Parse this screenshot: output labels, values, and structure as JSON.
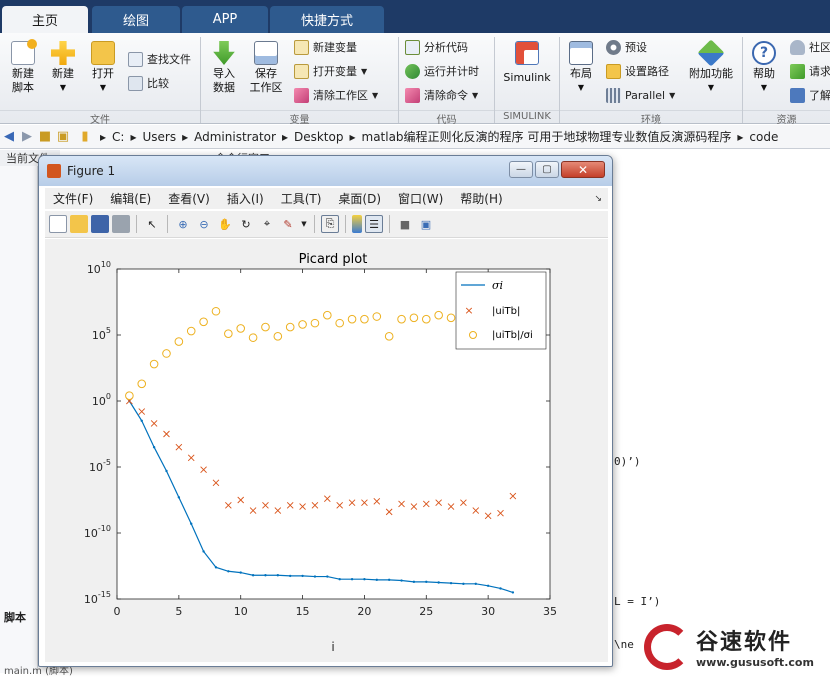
{
  "tabs": [
    {
      "label": "主页",
      "active": true
    },
    {
      "label": "绘图",
      "active": false
    },
    {
      "label": "APP",
      "active": false
    },
    {
      "label": "快捷方式",
      "active": false
    }
  ],
  "ribbon": {
    "file": {
      "new_script": "新建\n脚本",
      "new": "新建",
      "open": "打开",
      "find_files": "查找文件",
      "compare": "比较",
      "section": "文件"
    },
    "variable": {
      "import_data": "导入\n数据",
      "save_workspace": "保存\n工作区",
      "new_variable": "新建变量",
      "open_variable": "打开变量",
      "clear_workspace": "清除工作区",
      "section": "变量"
    },
    "code": {
      "analyze_code": "分析代码",
      "run_and_time": "运行并计时",
      "clear_commands": "清除命令",
      "section": "代码"
    },
    "simulink": {
      "simulink": "Simulink",
      "section": "SIMULINK"
    },
    "environment": {
      "layout": "布局",
      "preferences": "预设",
      "set_path": "设置路径",
      "parallel": "Parallel",
      "addons": "附加功能",
      "section": "环境"
    },
    "resources": {
      "help": "帮助",
      "community": "社区",
      "request": "请求",
      "learn": "了解",
      "section": "资源"
    }
  },
  "address": {
    "parts": [
      "C:",
      "Users",
      "Administrator",
      "Desktop",
      "matlab编程正则化反演的程序 可用于地球物理专业数值反演源码程序",
      "code"
    ]
  },
  "background": {
    "current_folder": "当前文件夹",
    "command_window": "命令行窗口",
    "snip1": "0)’)",
    "snip2": "L = I’)",
    "snip3": "\\ne",
    "script_label": "脚本",
    "main_file": "main.m (脚本)"
  },
  "figure": {
    "title": "Figure 1",
    "menu": [
      "文件(F)",
      "编辑(E)",
      "查看(V)",
      "插入(I)",
      "工具(T)",
      "桌面(D)",
      "窗口(W)",
      "帮助(H)"
    ]
  },
  "chart_data": {
    "type": "scatter",
    "title": "Picard plot",
    "xlabel": "i",
    "ylabel": "",
    "xlim": [
      0,
      35
    ],
    "ylim_exponent": [
      -15,
      10
    ],
    "yscale": "log",
    "xticks": [
      0,
      5,
      10,
      15,
      20,
      25,
      30,
      35
    ],
    "yticks_exp": [
      -15,
      -10,
      -5,
      0,
      5,
      10
    ],
    "grid": false,
    "legend": {
      "position": "top-right"
    },
    "series": [
      {
        "name": "σi",
        "style": "line",
        "color": "#0072bd",
        "x": [
          1,
          2,
          3,
          4,
          5,
          6,
          7,
          8,
          9,
          10,
          11,
          12,
          13,
          14,
          15,
          16,
          17,
          18,
          19,
          20,
          21,
          22,
          23,
          24,
          25,
          26,
          27,
          28,
          29,
          30,
          31,
          32
        ],
        "log10_y": [
          0,
          -1.5,
          -3.5,
          -5.3,
          -7.3,
          -9.3,
          -11.4,
          -12.6,
          -12.9,
          -13.0,
          -13.2,
          -13.2,
          -13.2,
          -13.25,
          -13.25,
          -13.3,
          -13.3,
          -13.5,
          -13.5,
          -13.5,
          -13.55,
          -13.55,
          -13.6,
          -13.7,
          -13.7,
          -13.75,
          -13.8,
          -13.85,
          -13.85,
          -14.0,
          -14.2,
          -14.5
        ]
      },
      {
        "name": "|uiTb|",
        "style": "x",
        "color": "#d95319",
        "x": [
          1,
          2,
          3,
          4,
          5,
          6,
          7,
          8,
          9,
          10,
          11,
          12,
          13,
          14,
          15,
          16,
          17,
          18,
          19,
          20,
          21,
          22,
          23,
          24,
          25,
          26,
          27,
          28,
          29,
          30,
          31,
          32
        ],
        "log10_y": [
          0,
          -0.8,
          -1.7,
          -2.5,
          -3.5,
          -4.3,
          -5.2,
          -6.2,
          -7.9,
          -7.5,
          -8.3,
          -7.9,
          -8.3,
          -7.9,
          -8.0,
          -7.9,
          -7.4,
          -7.9,
          -7.7,
          -7.7,
          -7.6,
          -8.4,
          -7.8,
          -8.0,
          -7.8,
          -7.7,
          -8.0,
          -7.7,
          -8.3,
          -8.7,
          -8.5,
          -7.2
        ]
      },
      {
        "name": "|uiTb|/σi",
        "style": "circle",
        "color": "#edb120",
        "x": [
          1,
          2,
          3,
          4,
          5,
          6,
          7,
          8,
          9,
          10,
          11,
          12,
          13,
          14,
          15,
          16,
          17,
          18,
          19,
          20,
          21,
          22,
          23,
          24,
          25,
          26,
          27,
          28,
          29,
          30,
          31,
          32
        ],
        "log10_y": [
          0.4,
          1.3,
          2.8,
          3.6,
          4.5,
          5.3,
          6.0,
          6.8,
          5.1,
          5.5,
          4.8,
          5.6,
          4.9,
          5.6,
          5.8,
          5.9,
          6.5,
          5.9,
          6.2,
          6.2,
          6.4,
          4.9,
          6.2,
          6.3,
          6.2,
          6.5,
          6.3,
          6.0,
          5.6,
          5.3,
          6.0,
          7.1
        ]
      }
    ]
  },
  "watermark": {
    "name": "谷速软件",
    "url": "www.gususoft.com"
  }
}
